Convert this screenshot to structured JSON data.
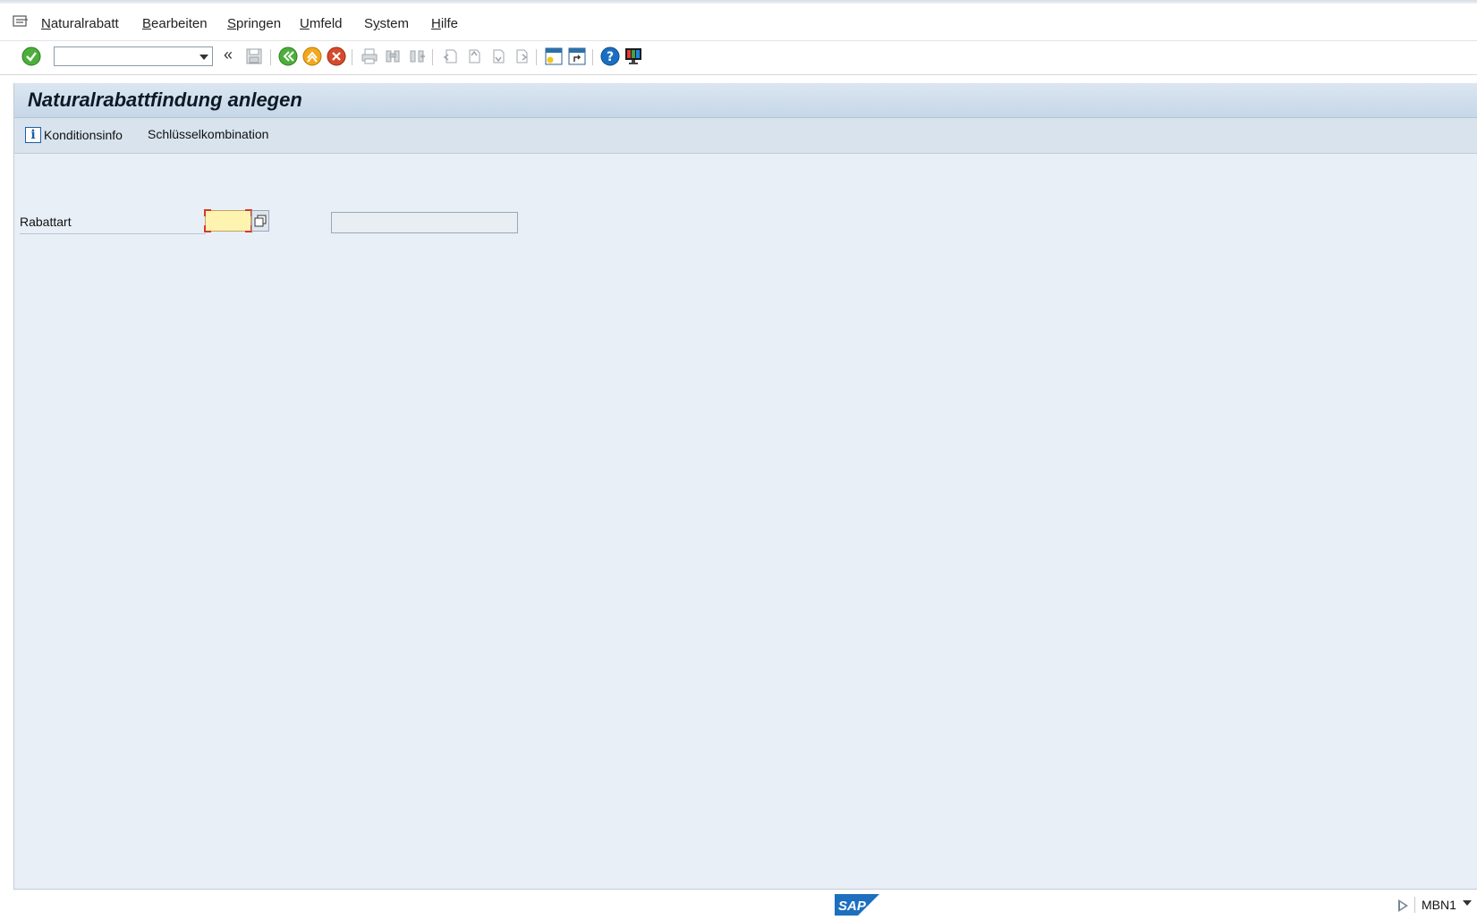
{
  "menubar": {
    "items": [
      {
        "label": "Naturalrabatt",
        "mnemonic": "N"
      },
      {
        "label": "Bearbeiten",
        "mnemonic": "B"
      },
      {
        "label": "Springen",
        "mnemonic": "S"
      },
      {
        "label": "Umfeld",
        "mnemonic": "U"
      },
      {
        "label": "System",
        "mnemonic": "y"
      },
      {
        "label": "Hilfe",
        "mnemonic": "H"
      }
    ]
  },
  "toolbar": {
    "command_field": {
      "value": "",
      "placeholder": ""
    },
    "icons": [
      "enter-icon",
      "command-dropdown-icon",
      "collapse-icon",
      "save-icon",
      "back-icon",
      "exit-icon",
      "cancel-icon",
      "print-icon",
      "find-icon",
      "find-next-icon",
      "first-page-icon",
      "previous-page-icon",
      "next-page-icon",
      "last-page-icon",
      "create-session-icon",
      "shortcut-icon",
      "help-icon",
      "customize-layout-icon"
    ]
  },
  "screen": {
    "title": "Naturalrabattfindung anlegen",
    "app_toolbar": {
      "konditionsinfo_label": "Konditionsinfo",
      "schluesselkombination_label": "Schlüsselkombination"
    },
    "fields": {
      "rabattart": {
        "label": "Rabattart",
        "value": "",
        "description": ""
      }
    }
  },
  "statusbar": {
    "logo": "SAP",
    "tcode": "MBN1"
  },
  "colors": {
    "frame_bg": "#e8eff6",
    "title_bar": "#c6d7e8",
    "required_input": "#fff3b0",
    "enter_green": "#4caf3a",
    "cancel_red": "#d64a2c",
    "help_blue": "#1b6fc2"
  }
}
